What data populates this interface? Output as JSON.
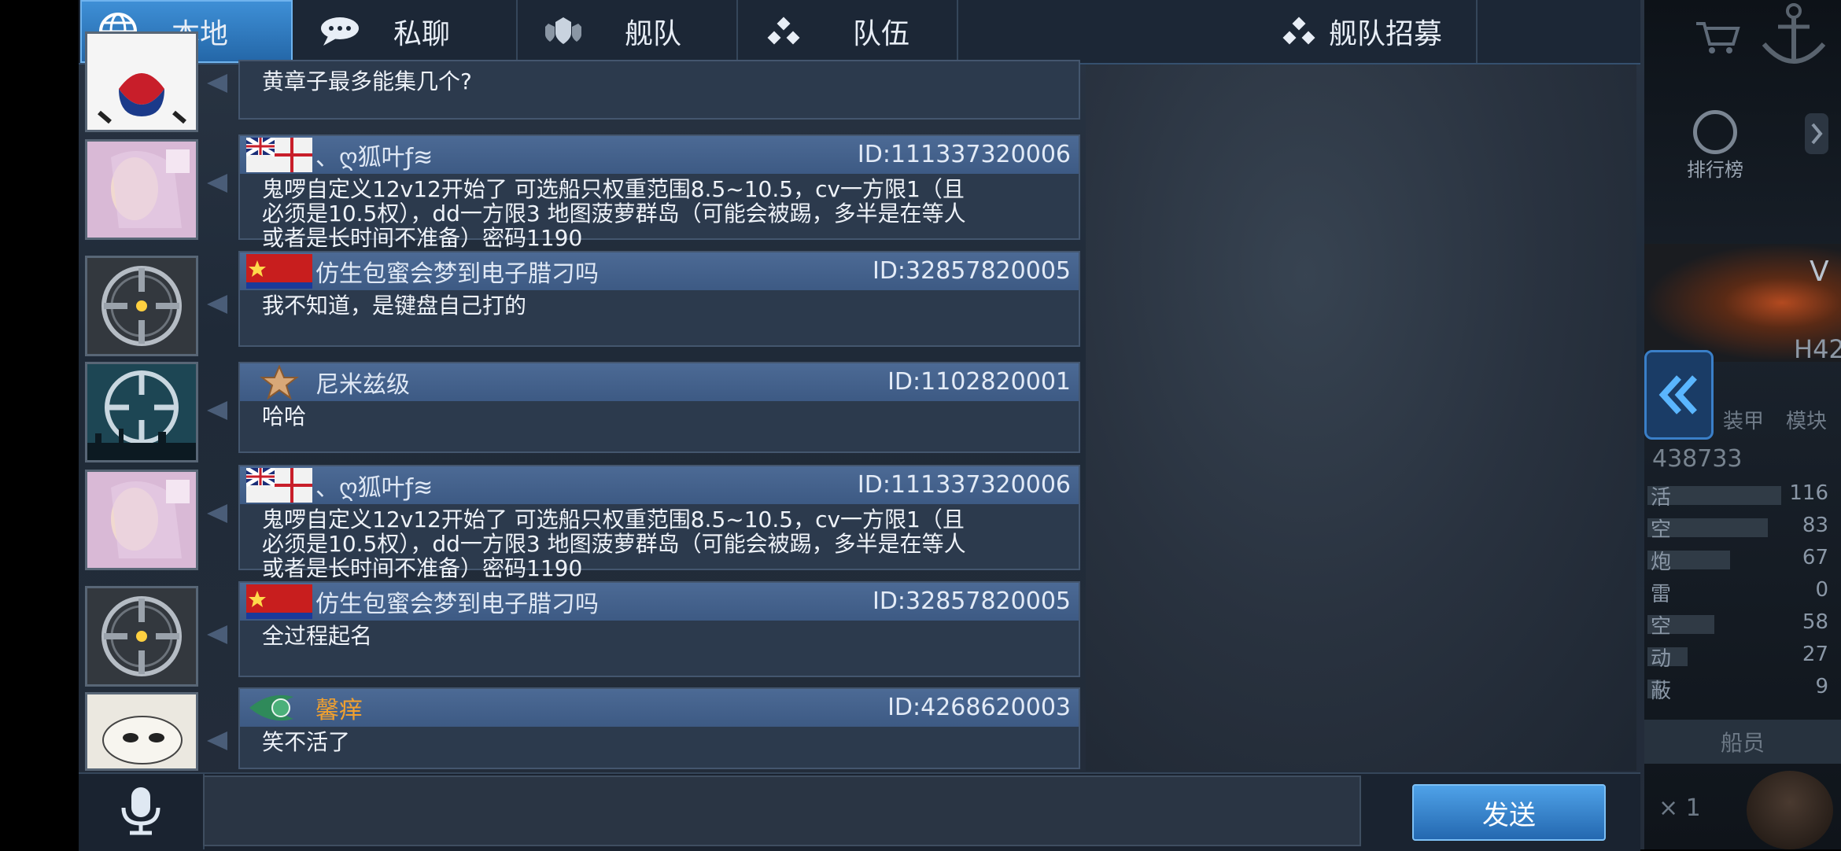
{
  "tabs": [
    {
      "label": "本地",
      "icon": "globe-icon",
      "active": true
    },
    {
      "label": "私聊",
      "icon": "speech-bubble-icon",
      "active": false
    },
    {
      "label": "舰队",
      "icon": "fleet-shield-icon",
      "active": false
    },
    {
      "label": "队伍",
      "icon": "team-dots-icon",
      "active": false
    },
    {
      "label": "舰队招募",
      "icon": "recruit-dots-icon",
      "active": false
    }
  ],
  "messages": [
    {
      "name": "",
      "id": "",
      "text": "黄章子最多能集几个?",
      "avatar": "emblem-avatar",
      "flag": ""
    },
    {
      "name": "、ღ狐叶ƒ≋",
      "id": "ID:111337320006",
      "text": "鬼啰自定义12v12开始了 可选船只权重范围8.5~10.5，cv一方限1（且必须是10.5权），dd一方限3 地图菠萝群岛（可能会被踢，多半是在等人或者是长时间不准备）密码1190",
      "avatar": "anime-girl-avatar",
      "flag": "uk-naval-ensign-flag"
    },
    {
      "name": "仿生包蜜会梦到电子腊刁吗",
      "id": "ID:32857820005",
      "text": "我不知道，是键盘自己打的",
      "avatar": "crosshair-avatar",
      "flag": "red-star-flag"
    },
    {
      "name": "尼米兹级",
      "id": "ID:1102820001",
      "text": "哈哈",
      "avatar": "crosshair-blue-avatar",
      "flag": "rank-star-badge"
    },
    {
      "name": "、ღ狐叶ƒ≋",
      "id": "ID:111337320006",
      "text": "鬼啰自定义12v12开始了 可选船只权重范围8.5~10.5，cv一方限1（且必须是10.5权），dd一方限3 地图菠萝群岛（可能会被踢，多半是在等人或者是长时间不准备）密码1190",
      "avatar": "anime-girl-avatar",
      "flag": "uk-naval-ensign-flag"
    },
    {
      "name": "仿生包蜜会梦到电子腊刁吗",
      "id": "ID:32857820005",
      "text": "全过程起名",
      "avatar": "crosshair-avatar",
      "flag": "red-star-flag"
    },
    {
      "name": "馨痒",
      "id": "ID:4268620003",
      "text": "笑不活了",
      "avatar": "cat-avatar",
      "flag": "green-wing-badge",
      "name_color": "#f0a030"
    }
  ],
  "input": {
    "placeholder": "",
    "value": ""
  },
  "send_label": "发送",
  "rightside": {
    "leaderboard_label": "排行榜",
    "ship_letter": "V",
    "hull_code": "H42",
    "tab_labels": [
      "装甲",
      "模块"
    ],
    "score": "438733",
    "stats": [
      {
        "label": "活",
        "value": "116",
        "fill": 1.0
      },
      {
        "label": "空",
        "value": "83",
        "fill": 0.9
      },
      {
        "label": "炮",
        "value": "67",
        "fill": 0.62
      },
      {
        "label": "雷",
        "value": "0",
        "fill": 0
      },
      {
        "label": "空",
        "value": "58",
        "fill": 0.5
      },
      {
        "label": "动",
        "value": "27",
        "fill": 0.3
      },
      {
        "label": "蔽",
        "value": "9",
        "fill": 0.1
      }
    ],
    "crew_label": "船员",
    "count_label": "× 1"
  },
  "colors": {
    "accent": "#3e8fd6",
    "bubble_header": "#4c6a95",
    "bubble_body": "#2c3a4d",
    "special_name": "#f0a030"
  }
}
